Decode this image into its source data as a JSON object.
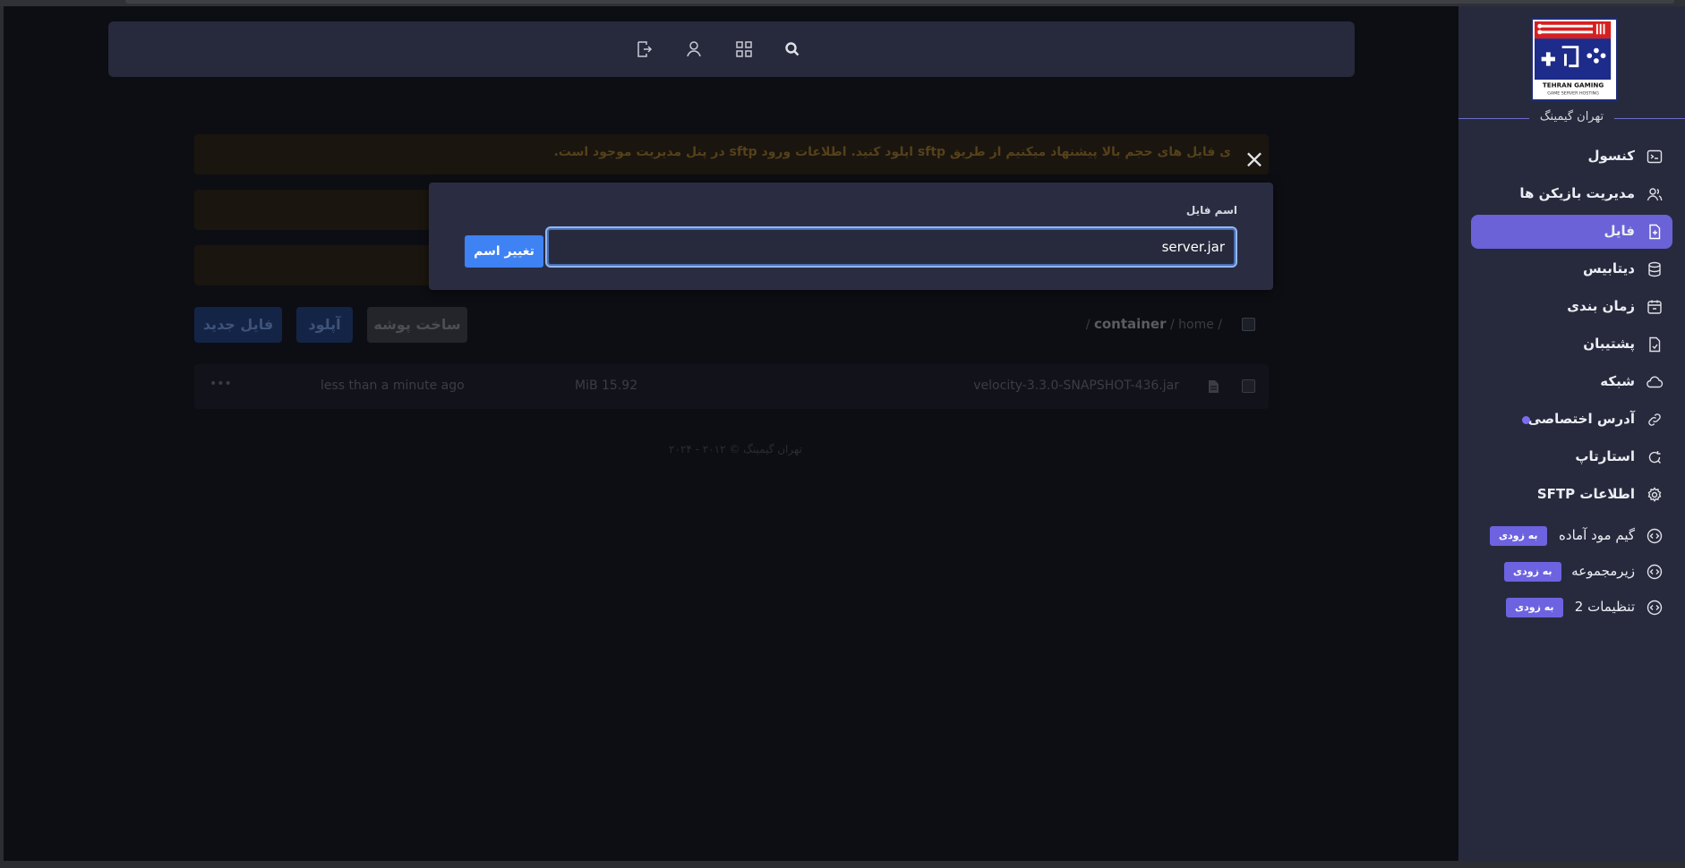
{
  "warning": {
    "text": "ی فایل های حجم بالا پیشنهاد میکنیم از طریق sftp اپلود کنید. اطلاعات ورود sftp در پنل مدیریت موجود است."
  },
  "toolbar": {
    "new_file": "فایل جدید",
    "upload": "آپلود",
    "new_folder": "ساخت پوشه"
  },
  "breadcrumb": {
    "sep": "/",
    "home": "home",
    "current": "container"
  },
  "files": [
    {
      "name": "velocity-3.3.0-SNAPSHOT-436.jar",
      "size": "MiB 15.92",
      "modified": "less than a minute ago",
      "more": "•••"
    }
  ],
  "footer": "تهران گیمینگ © ۲۰۱۲ - ۲۰۲۴",
  "modal": {
    "label": "اسم فایل",
    "value": "server.jar",
    "button": "تغییر اسم",
    "close": "×"
  },
  "sidebar": {
    "brand": "تهران گیمینگ",
    "logo_title": "TEHRAN GAMING",
    "logo_subtitle": "GAME SERVER HOSTING",
    "items": [
      {
        "label": "کنسول",
        "icon": "terminal-icon"
      },
      {
        "label": "مدیریت بازیکن ها",
        "icon": "users-icon"
      },
      {
        "label": "فایل",
        "icon": "file-icon"
      },
      {
        "label": "دیتابیس",
        "icon": "database-icon"
      },
      {
        "label": "زمان بندی",
        "icon": "calendar-icon"
      },
      {
        "label": "پشتیبان",
        "icon": "backup-icon"
      },
      {
        "label": "شبکه",
        "icon": "cloud-icon"
      },
      {
        "label": "آدرس اختصاصی",
        "icon": "link-icon"
      },
      {
        "label": "استارتاپ",
        "icon": "refresh-icon"
      },
      {
        "label": "اطلاعات SFTP",
        "icon": "gear-icon"
      },
      {
        "label": "گیم مود آماده",
        "icon": "code-icon",
        "badge": "به زودی"
      },
      {
        "label": "زیرمجموعه",
        "icon": "code-icon",
        "badge": "به زودی"
      },
      {
        "label": "تنظیمات 2",
        "icon": "code-icon",
        "badge": "به زودی"
      }
    ]
  },
  "colors": {
    "accent": "#6a62d6",
    "primary_button": "#3e82f4",
    "sidebar_bg": "#272a3c",
    "main_bg": "#0d0e13"
  }
}
